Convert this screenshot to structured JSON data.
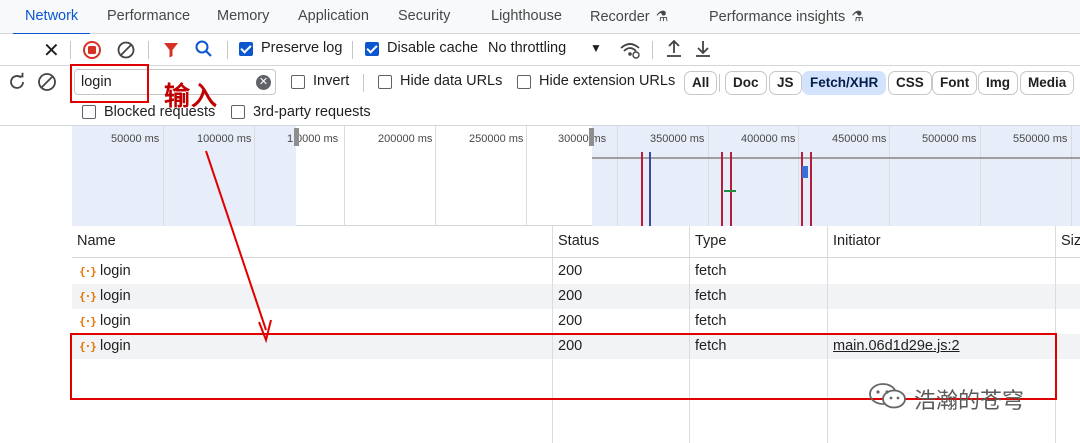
{
  "tabs": [
    {
      "label": "Network",
      "active": true
    },
    {
      "label": "Performance"
    },
    {
      "label": "Memory"
    },
    {
      "label": "Application"
    },
    {
      "label": "Security"
    },
    {
      "label": "Lighthouse"
    },
    {
      "label": "Recorder"
    },
    {
      "label": "Performance insights"
    }
  ],
  "toolbar": {
    "preserve_log_label": "Preserve log",
    "preserve_log_checked": true,
    "disable_cache_label": "Disable cache",
    "disable_cache_checked": true,
    "throttling_value": "No throttling"
  },
  "filter_bar": {
    "filter_value": "login",
    "invert_label": "Invert",
    "hide_data_urls_label": "Hide data URLs",
    "hide_extension_urls_label": "Hide extension URLs",
    "type_filters": [
      "All",
      "Doc",
      "JS",
      "Fetch/XHR",
      "CSS",
      "Font",
      "Img",
      "Media"
    ],
    "selected_type": "Fetch/XHR",
    "blocked_requests_label": "Blocked requests",
    "third_party_label": "3rd-party requests"
  },
  "overview": {
    "ticks": [
      "50000 ms",
      "100000 ms",
      "1|0000 ms",
      "200000 ms",
      "250000 ms",
      "30000|ms",
      "350000 ms",
      "400000 ms",
      "450000 ms",
      "500000 ms",
      "550000 ms"
    ]
  },
  "table": {
    "columns": [
      "Name",
      "Status",
      "Type",
      "Initiator",
      "Siz"
    ],
    "rows": [
      {
        "name": "login",
        "status": "200",
        "type": "fetch",
        "initiator": ""
      },
      {
        "name": "login",
        "status": "200",
        "type": "fetch",
        "initiator": ""
      },
      {
        "name": "login",
        "status": "200",
        "type": "fetch",
        "initiator": ""
      },
      {
        "name": "login",
        "status": "200",
        "type": "fetch",
        "initiator": "main.06d1d29e.js:2"
      }
    ]
  },
  "annotation": {
    "label": "输入"
  },
  "watermark": {
    "text": "浩瀚的苍穹"
  },
  "colors": {
    "accent": "#0b57d0",
    "annotation_red": "#e10000",
    "record_red": "#d93025"
  }
}
